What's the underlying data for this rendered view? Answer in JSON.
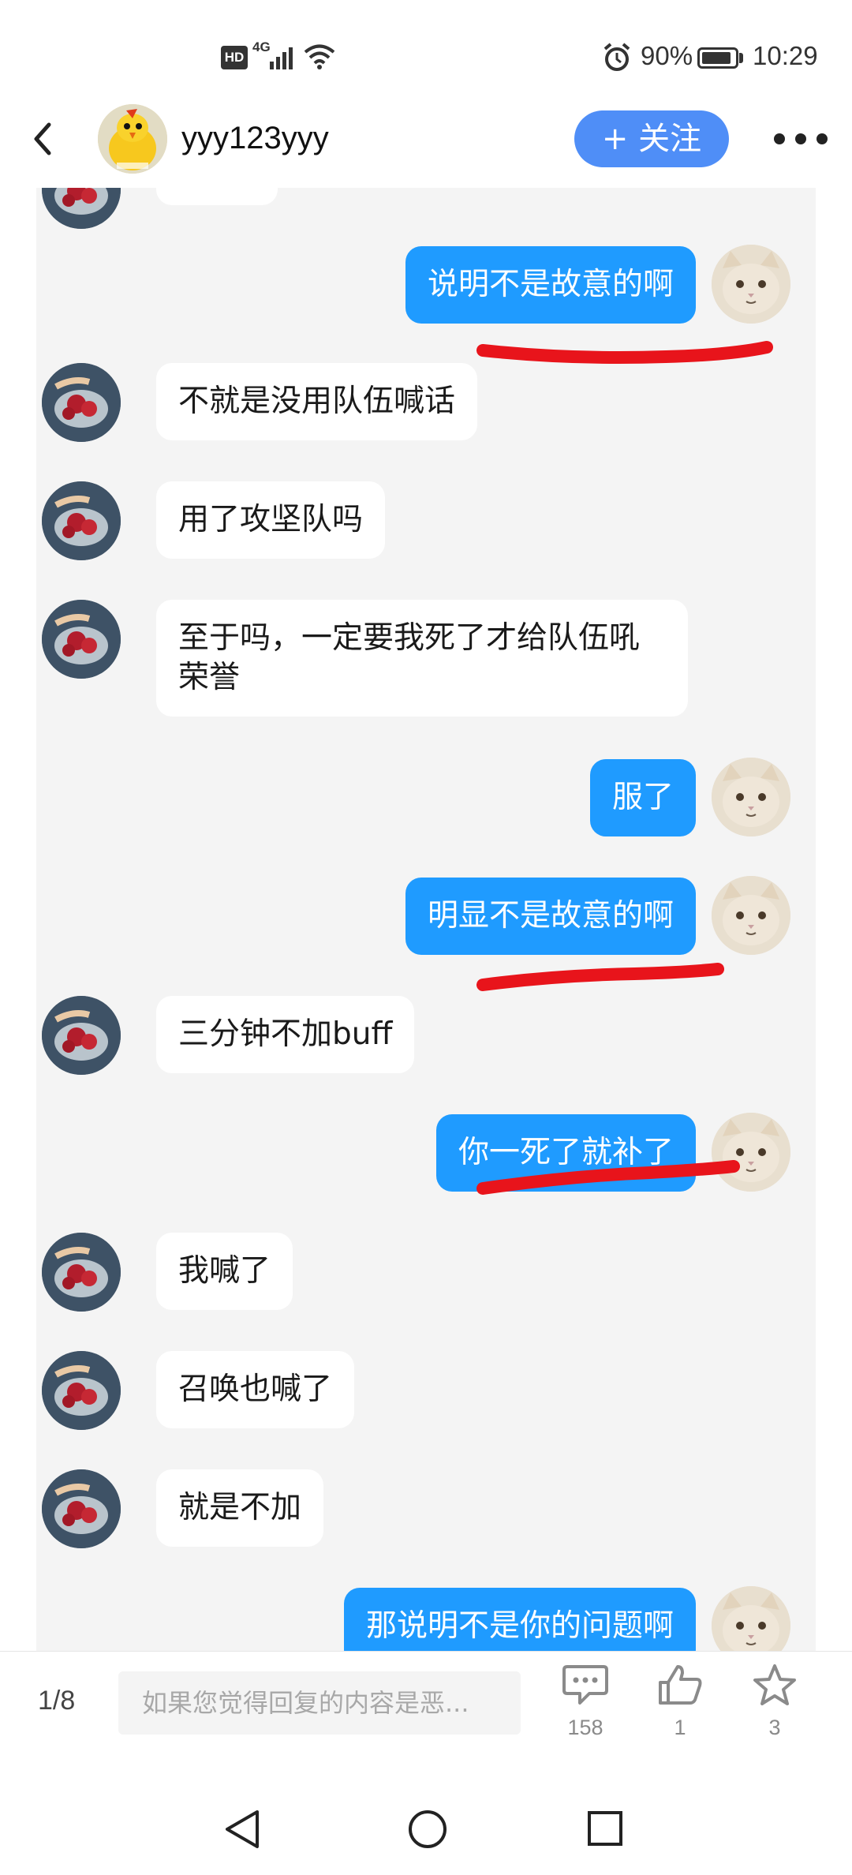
{
  "status_bar": {
    "hd": "HD",
    "network": "4G",
    "battery_pct": "90%",
    "battery_level": 0.9,
    "time": "10:29"
  },
  "header": {
    "username": "yyy123yyy",
    "follow_label": "+ 关注"
  },
  "messages": [
    {
      "side": "in",
      "text": ""
    },
    {
      "side": "out",
      "text": "说明不是故意的啊",
      "underlined": true
    },
    {
      "side": "in",
      "text": "不就是没用队伍喊话"
    },
    {
      "side": "in",
      "text": "用了攻坚队吗"
    },
    {
      "side": "in",
      "text": "至于吗，一定要我死了才给队伍吼荣誉"
    },
    {
      "side": "out",
      "text": "服了"
    },
    {
      "side": "out",
      "text": "明显不是故意的啊",
      "underlined": true
    },
    {
      "side": "in",
      "text": "三分钟不加buff"
    },
    {
      "side": "out",
      "text": "你一死了就补了",
      "underlined": true
    },
    {
      "side": "in",
      "text": "我喊了"
    },
    {
      "side": "in",
      "text": "召唤也喊了"
    },
    {
      "side": "in",
      "text": "就是不加"
    },
    {
      "side": "out",
      "text": "那说明不是你的问题啊"
    }
  ],
  "bottom_bar": {
    "page": "1/8",
    "reply_placeholder": "如果您觉得回复的内容是恶...",
    "comments_count": "158",
    "likes_count": "1",
    "favorites_count": "3"
  },
  "colors": {
    "accent": "#1f9bff",
    "follow_button": "#4f8ef7",
    "annotation_underline": "#e8141b",
    "chat_background": "#f4f4f4"
  },
  "icons": [
    "back-icon",
    "more-icon",
    "comment-icon",
    "like-icon",
    "star-icon",
    "nav-back-icon",
    "nav-home-icon",
    "nav-recent-icon",
    "alarm-icon",
    "wifi-icon",
    "signal-icon",
    "battery-icon"
  ]
}
